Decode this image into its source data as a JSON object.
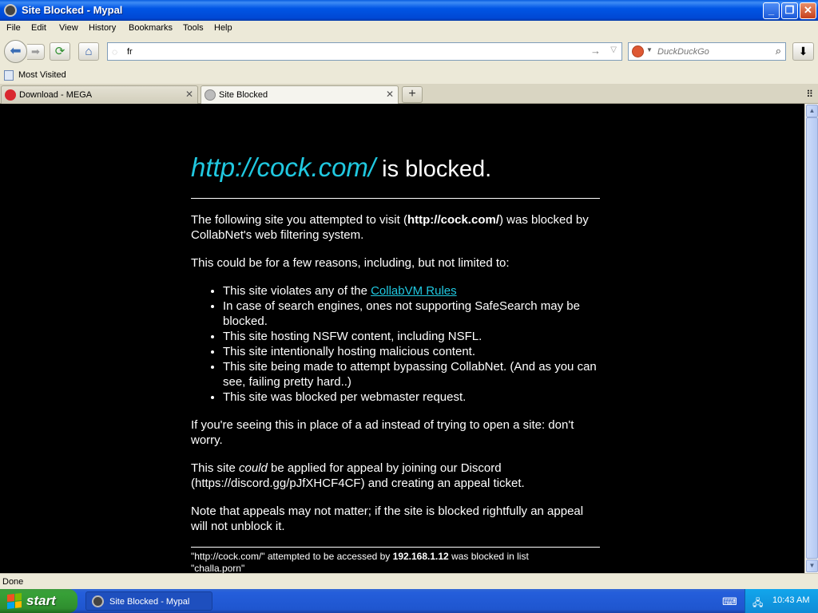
{
  "window": {
    "title": "Site Blocked - Mypal"
  },
  "menu": [
    "File",
    "Edit",
    "View",
    "History",
    "Bookmarks",
    "Tools",
    "Help"
  ],
  "nav": {
    "url_value": "fr",
    "search_placeholder": "DuckDuckGo"
  },
  "bookmarks": {
    "most_visited": "Most Visited"
  },
  "tabs": [
    {
      "label": "Download - MEGA",
      "active": false
    },
    {
      "label": "Site Blocked",
      "active": true
    }
  ],
  "page": {
    "blocked_url": "http://cock.com/",
    "heading_suffix": "is blocked.",
    "intro_pre": "The following site you attempted to visit (",
    "intro_url": "http://cock.com/",
    "intro_post": ") was blocked by CollabNet's web filtering system.",
    "reasons_intro": "This could be for a few reasons, including, but not limited to:",
    "reason_1_pre": "This site violates any of the ",
    "reason_1_link": "CollabVM Rules",
    "reasons": [
      "In case of search engines, ones not supporting SafeSearch may be blocked.",
      "This site hosting NSFW content, including NSFL.",
      "This site intentionally hosting malicious content.",
      "This site being made to attempt bypassing CollabNet. (And as you can see, failing pretty hard..)",
      "This site was blocked per webmaster request."
    ],
    "ad_note": "If you're seeing this in place of a ad instead of trying to open a site: don't worry.",
    "appeal_pre": "This site ",
    "appeal_em": "could",
    "appeal_post": " be applied for appeal by joining our Discord (https://discord.gg/pJfXHCF4CF) and creating an appeal ticket.",
    "appeal_note": "Note that appeals may not matter; if the site is blocked rightfully an appeal will not unblock it.",
    "footer_pre": "\"http://cock.com/\" attempted to be accessed by ",
    "footer_ip": "192.168.1.12",
    "footer_mid": " was blocked in list",
    "footer_list": "\"challa.porn\""
  },
  "status": {
    "text": "Done"
  },
  "taskbar": {
    "start_label": "start",
    "task_label": "Site Blocked - Mypal",
    "clock": "10:43 AM"
  },
  "colors": {
    "link": "#20c8e0",
    "page_bg": "#000000",
    "titlebar": "#0055e5",
    "start": "#37a037"
  }
}
